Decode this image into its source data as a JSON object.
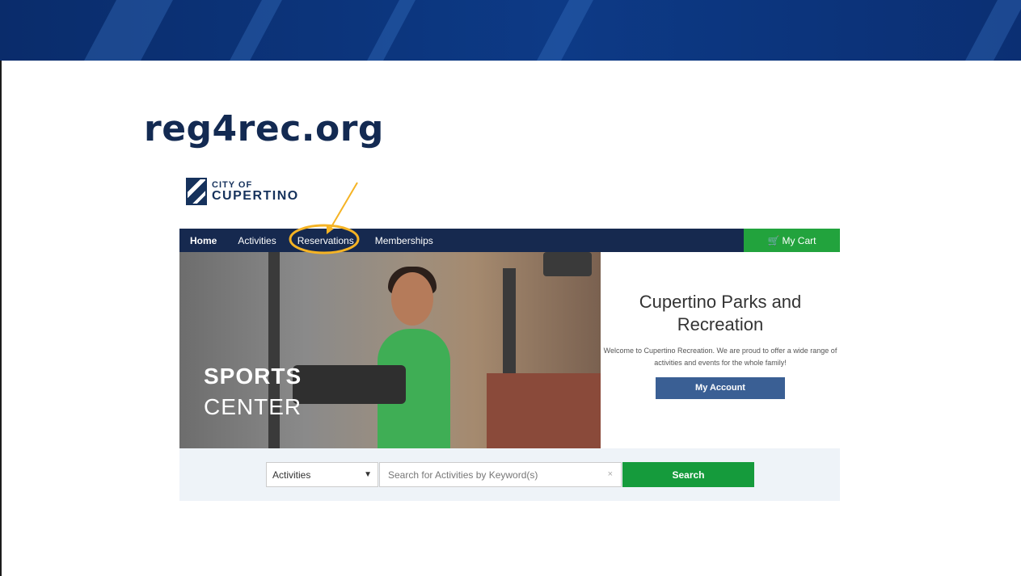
{
  "slide": {
    "title": "reg4rec.org",
    "accent_color": "#0d3a86",
    "highlight_color": "#f5b324"
  },
  "site": {
    "logo": {
      "line1": "CITY OF",
      "line2": "CUPERTINO"
    },
    "nav": {
      "items": [
        {
          "label": "Home",
          "active": true
        },
        {
          "label": "Activities",
          "active": false
        },
        {
          "label": "Reservations",
          "active": false,
          "highlighted": true
        },
        {
          "label": "Memberships",
          "active": false
        }
      ],
      "cart_label": "My Cart",
      "cart_icon": "cart-icon"
    },
    "hero": {
      "image_text_line1": "SPORTS",
      "image_text_line2": "CENTER",
      "title": "Cupertino Parks and Recreation",
      "description": "Welcome to Cupertino Recreation. We are proud to offer a wide range of activities and events for the whole family!",
      "account_button": "My Account"
    },
    "search": {
      "category": "Activities",
      "placeholder": "Search for Activities by Keyword(s)",
      "clear_symbol": "×",
      "button": "Search"
    }
  }
}
